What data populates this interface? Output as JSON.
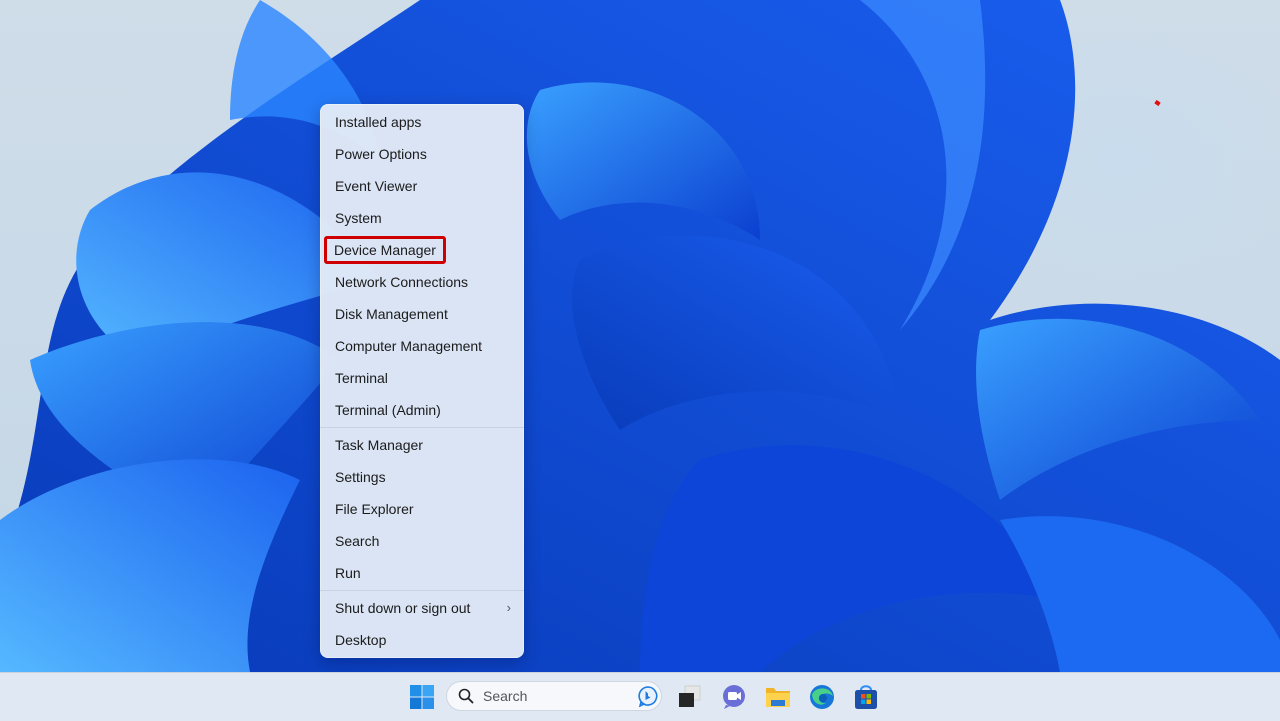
{
  "desktop": {
    "wallpaper": "windows-11-bloom",
    "colors": {
      "bloom_dark": "#0a3fd6",
      "bloom_mid": "#1f6cf2",
      "bloom_light": "#4fb0ff",
      "background": "#c8d8e8"
    }
  },
  "context_menu": {
    "groups": [
      {
        "items": [
          {
            "label": "Installed apps"
          },
          {
            "label": "Power Options"
          },
          {
            "label": "Event Viewer"
          },
          {
            "label": "System"
          },
          {
            "label": "Device Manager",
            "highlighted": true
          },
          {
            "label": "Network Connections"
          },
          {
            "label": "Disk Management"
          },
          {
            "label": "Computer Management"
          },
          {
            "label": "Terminal"
          },
          {
            "label": "Terminal (Admin)"
          }
        ]
      },
      {
        "items": [
          {
            "label": "Task Manager"
          },
          {
            "label": "Settings"
          },
          {
            "label": "File Explorer"
          },
          {
            "label": "Search"
          },
          {
            "label": "Run"
          }
        ]
      },
      {
        "items": [
          {
            "label": "Shut down or sign out",
            "submenu": true,
            "chevron": "›"
          },
          {
            "label": "Desktop"
          }
        ]
      }
    ],
    "highlight_color": "#d00000"
  },
  "taskbar": {
    "search": {
      "placeholder": "Search"
    },
    "icons": [
      {
        "name": "start-icon"
      },
      {
        "name": "task-view-icon"
      },
      {
        "name": "teams-chat-icon"
      },
      {
        "name": "file-explorer-icon"
      },
      {
        "name": "edge-icon"
      },
      {
        "name": "microsoft-store-icon"
      }
    ]
  }
}
